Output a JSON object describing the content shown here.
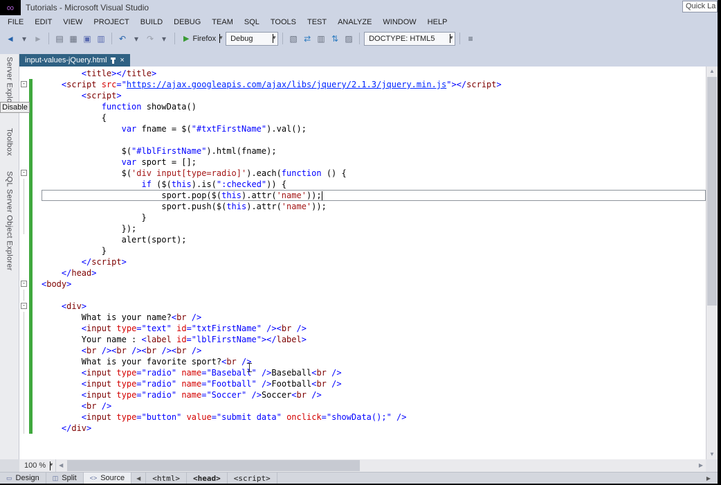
{
  "window": {
    "title": "Tutorials - Microsoft Visual Studio",
    "quick_launch": "Quick La",
    "logo_glyph": "∞"
  },
  "menu": {
    "items": [
      "FILE",
      "EDIT",
      "VIEW",
      "PROJECT",
      "BUILD",
      "DEBUG",
      "TEAM",
      "SQL",
      "TOOLS",
      "TEST",
      "ANALYZE",
      "WINDOW",
      "HELP"
    ]
  },
  "toolbar": {
    "nav_icons": [
      {
        "name": "navigate-back-icon",
        "glyph": "◄",
        "color": "#2563ab"
      },
      {
        "name": "navigate-back-dropdown-icon",
        "glyph": "▾",
        "color": "#5a6170"
      },
      {
        "name": "navigate-forward-icon",
        "glyph": "►",
        "color": "#9aa0ac"
      }
    ],
    "file_icons": [
      {
        "name": "new-file-icon",
        "glyph": "▤",
        "color": "#68707f"
      },
      {
        "name": "open-file-icon",
        "glyph": "▦",
        "color": "#68707f"
      },
      {
        "name": "save-icon",
        "glyph": "▣",
        "color": "#5a6bb0"
      },
      {
        "name": "save-all-icon",
        "glyph": "▥",
        "color": "#5a6bb0"
      }
    ],
    "edit_icons": [
      {
        "name": "undo-icon",
        "glyph": "↶",
        "color": "#2563ab"
      },
      {
        "name": "undo-dropdown-icon",
        "glyph": "▾",
        "color": "#5a6170"
      },
      {
        "name": "redo-icon",
        "glyph": "↷",
        "color": "#9aa0ac"
      },
      {
        "name": "redo-dropdown-icon",
        "glyph": "▾",
        "color": "#5a6170"
      }
    ],
    "run": {
      "play_glyph": "▶",
      "browser": "Firefox",
      "caret": "▾"
    },
    "config": {
      "value": "Debug",
      "caret": "▾"
    },
    "mid_icons": [
      {
        "name": "attach-debugger-icon",
        "glyph": "▧",
        "color": "#68707f"
      },
      {
        "name": "page-inspector-icon",
        "glyph": "⇄",
        "color": "#2e7cc0"
      },
      {
        "name": "browser-preview-icon",
        "glyph": "▥",
        "color": "#68707f"
      },
      {
        "name": "sync-icon",
        "glyph": "⇅",
        "color": "#2e7cc0"
      },
      {
        "name": "stylesheet-icon",
        "glyph": "▨",
        "color": "#68707f"
      }
    ],
    "doctype": {
      "value": "DOCTYPE: HTML5",
      "caret": "▾"
    },
    "right_icons": [
      {
        "name": "formatting-icon",
        "glyph": "≡",
        "color": "#474e5c"
      }
    ]
  },
  "tabstrip": {
    "tab_label": "input-values-jQuery.html",
    "close_icon": "×"
  },
  "side_panel": {
    "tabs": [
      "Server Explorer",
      "Toolbox",
      "SQL Server Object Explorer"
    ],
    "disable_label": "Disable"
  },
  "scrollbars": {
    "up": "▲",
    "down": "▼",
    "left": "◀",
    "right": "▶"
  },
  "bottom": {
    "zoom": "100 %",
    "zoom_caret": "▾",
    "views": [
      {
        "label": "Design",
        "icon": "▭",
        "active": false
      },
      {
        "label": "Split",
        "icon": "◫",
        "active": false
      },
      {
        "label": "Source",
        "icon": "<>",
        "active": true
      }
    ],
    "nav_left": "◀",
    "nav_right": "▶",
    "breadcrumb": [
      {
        "label": "<html>",
        "active": false
      },
      {
        "label": "<head>",
        "active": true
      },
      {
        "label": "<script>",
        "active": false
      }
    ]
  },
  "editor": {
    "fold_glyph": "-",
    "lines": [
      {
        "ch": 0,
        "s": [
          [
            "p",
            "        "
          ],
          [
            "b",
            "<"
          ],
          [
            "m",
            "title"
          ],
          [
            "b",
            "></"
          ],
          [
            "m",
            "title"
          ],
          [
            "b",
            ">"
          ]
        ]
      },
      {
        "ch": 1,
        "f": 1,
        "s": [
          [
            "p",
            "    "
          ],
          [
            "b",
            "<"
          ],
          [
            "m",
            "script"
          ],
          [
            "p",
            " "
          ],
          [
            "r",
            "src"
          ],
          [
            "b",
            "=\""
          ],
          [
            "l",
            "https://ajax.googleapis.com/ajax/libs/jquery/2.1.3/jquery.min.js"
          ],
          [
            "b",
            "\"></"
          ],
          [
            "m",
            "script"
          ],
          [
            "b",
            ">"
          ]
        ]
      },
      {
        "ch": 1,
        "s": [
          [
            "p",
            "        "
          ],
          [
            "b",
            "<"
          ],
          [
            "m",
            "script"
          ],
          [
            "b",
            ">"
          ]
        ]
      },
      {
        "ch": 1,
        "s": [
          [
            "p",
            "            "
          ],
          [
            "b",
            "function"
          ],
          [
            "p",
            " showData()"
          ]
        ]
      },
      {
        "ch": 1,
        "s": [
          [
            "p",
            "            {"
          ]
        ]
      },
      {
        "ch": 1,
        "s": [
          [
            "p",
            "                "
          ],
          [
            "b",
            "var"
          ],
          [
            "p",
            " fname = $("
          ],
          [
            "b",
            "\"#txtFirstName\""
          ],
          [
            "p",
            ").val();"
          ]
        ]
      },
      {
        "ch": 1,
        "s": []
      },
      {
        "ch": 1,
        "s": [
          [
            "p",
            "                $("
          ],
          [
            "b",
            "\"#lblFirstName\""
          ],
          [
            "p",
            ").html(fname);"
          ]
        ]
      },
      {
        "ch": 1,
        "s": [
          [
            "p",
            "                "
          ],
          [
            "b",
            "var"
          ],
          [
            "p",
            " sport = [];"
          ]
        ]
      },
      {
        "ch": 1,
        "f": 1,
        "s": [
          [
            "p",
            "                $("
          ],
          [
            "s",
            "'div input[type=radio]'"
          ],
          [
            "p",
            ").each("
          ],
          [
            "b",
            "function"
          ],
          [
            "p",
            " () {"
          ]
        ]
      },
      {
        "ch": 1,
        "g": 1,
        "s": [
          [
            "p",
            "                    "
          ],
          [
            "b",
            "if"
          ],
          [
            "p",
            " ($("
          ],
          [
            "b",
            "this"
          ],
          [
            "p",
            ").is("
          ],
          [
            "b",
            "\":checked\""
          ],
          [
            "p",
            ")) {"
          ]
        ]
      },
      {
        "ch": 1,
        "g": 1,
        "cur": 1,
        "caret": 1,
        "s": [
          [
            "p",
            "                        sport.pop($("
          ],
          [
            "b",
            "this"
          ],
          [
            "p",
            ").attr("
          ],
          [
            "s",
            "'name'"
          ],
          [
            "p",
            "));"
          ]
        ]
      },
      {
        "ch": 1,
        "g": 1,
        "s": [
          [
            "p",
            "                        sport.push($("
          ],
          [
            "b",
            "this"
          ],
          [
            "p",
            ").attr("
          ],
          [
            "s",
            "'name'"
          ],
          [
            "p",
            "));"
          ]
        ]
      },
      {
        "ch": 1,
        "g": 1,
        "s": [
          [
            "p",
            "                    }"
          ]
        ]
      },
      {
        "ch": 1,
        "g": 1,
        "s": [
          [
            "p",
            "                });"
          ]
        ]
      },
      {
        "ch": 1,
        "s": [
          [
            "p",
            "                alert(sport);"
          ]
        ]
      },
      {
        "ch": 1,
        "s": [
          [
            "p",
            "            }"
          ]
        ]
      },
      {
        "ch": 1,
        "s": [
          [
            "p",
            "        "
          ],
          [
            "b",
            "</"
          ],
          [
            "m",
            "script"
          ],
          [
            "b",
            ">"
          ]
        ]
      },
      {
        "ch": 1,
        "s": [
          [
            "p",
            "    "
          ],
          [
            "b",
            "</"
          ],
          [
            "m",
            "head"
          ],
          [
            "b",
            ">"
          ]
        ]
      },
      {
        "ch": 1,
        "f": 1,
        "s": [
          [
            "b",
            "<"
          ],
          [
            "m",
            "body"
          ],
          [
            "b",
            ">"
          ]
        ]
      },
      {
        "ch": 1,
        "g": 1,
        "s": []
      },
      {
        "ch": 1,
        "f": 1,
        "s": [
          [
            "p",
            "    "
          ],
          [
            "b",
            "<"
          ],
          [
            "m",
            "div"
          ],
          [
            "b",
            ">"
          ]
        ]
      },
      {
        "ch": 1,
        "g": 1,
        "s": [
          [
            "p",
            "        What is your name?"
          ],
          [
            "b",
            "<"
          ],
          [
            "m",
            "br"
          ],
          [
            "p",
            " "
          ],
          [
            "b",
            "/>"
          ]
        ]
      },
      {
        "ch": 1,
        "g": 1,
        "s": [
          [
            "p",
            "        "
          ],
          [
            "b",
            "<"
          ],
          [
            "m",
            "input"
          ],
          [
            "p",
            " "
          ],
          [
            "r",
            "type"
          ],
          [
            "b",
            "=\"text\""
          ],
          [
            "p",
            " "
          ],
          [
            "r",
            "id"
          ],
          [
            "b",
            "=\"txtFirstName\""
          ],
          [
            "p",
            " "
          ],
          [
            "b",
            "/><"
          ],
          [
            "m",
            "br"
          ],
          [
            "p",
            " "
          ],
          [
            "b",
            "/>"
          ]
        ]
      },
      {
        "ch": 1,
        "g": 1,
        "s": [
          [
            "p",
            "        Your name : "
          ],
          [
            "b",
            "<"
          ],
          [
            "m",
            "label"
          ],
          [
            "p",
            " "
          ],
          [
            "r",
            "id"
          ],
          [
            "b",
            "=\"lblFirstName\""
          ],
          [
            "b",
            "></"
          ],
          [
            "m",
            "label"
          ],
          [
            "b",
            ">"
          ]
        ]
      },
      {
        "ch": 1,
        "g": 1,
        "s": [
          [
            "p",
            "        "
          ],
          [
            "b",
            "<"
          ],
          [
            "m",
            "br"
          ],
          [
            "p",
            " "
          ],
          [
            "b",
            "/><"
          ],
          [
            "m",
            "br"
          ],
          [
            "p",
            " "
          ],
          [
            "b",
            "/><"
          ],
          [
            "m",
            "br"
          ],
          [
            "p",
            " "
          ],
          [
            "b",
            "/><"
          ],
          [
            "m",
            "br"
          ],
          [
            "p",
            " "
          ],
          [
            "b",
            "/>"
          ]
        ]
      },
      {
        "ch": 1,
        "g": 1,
        "s": [
          [
            "p",
            "        What is your favorite sport?"
          ],
          [
            "b",
            "<"
          ],
          [
            "m",
            "br"
          ],
          [
            "p",
            " "
          ],
          [
            "b",
            "/>"
          ]
        ]
      },
      {
        "ch": 1,
        "g": 1,
        "s": [
          [
            "p",
            "        "
          ],
          [
            "b",
            "<"
          ],
          [
            "m",
            "input"
          ],
          [
            "p",
            " "
          ],
          [
            "r",
            "type"
          ],
          [
            "b",
            "=\"radio\""
          ],
          [
            "p",
            " "
          ],
          [
            "r",
            "name"
          ],
          [
            "b",
            "=\"Baseball\""
          ],
          [
            "p",
            " "
          ],
          [
            "b",
            "/>"
          ],
          [
            "p",
            "Baseball"
          ],
          [
            "b",
            "<"
          ],
          [
            "m",
            "br"
          ],
          [
            "p",
            " "
          ],
          [
            "b",
            "/>"
          ]
        ]
      },
      {
        "ch": 1,
        "g": 1,
        "s": [
          [
            "p",
            "        "
          ],
          [
            "b",
            "<"
          ],
          [
            "m",
            "input"
          ],
          [
            "p",
            " "
          ],
          [
            "r",
            "type"
          ],
          [
            "b",
            "=\"radio\""
          ],
          [
            "p",
            " "
          ],
          [
            "r",
            "name"
          ],
          [
            "b",
            "=\"Football\""
          ],
          [
            "p",
            " "
          ],
          [
            "b",
            "/>"
          ],
          [
            "p",
            "Football"
          ],
          [
            "b",
            "<"
          ],
          [
            "m",
            "br"
          ],
          [
            "p",
            " "
          ],
          [
            "b",
            "/>"
          ]
        ]
      },
      {
        "ch": 1,
        "g": 1,
        "s": [
          [
            "p",
            "        "
          ],
          [
            "b",
            "<"
          ],
          [
            "m",
            "input"
          ],
          [
            "p",
            " "
          ],
          [
            "r",
            "type"
          ],
          [
            "b",
            "=\"radio\""
          ],
          [
            "p",
            " "
          ],
          [
            "r",
            "name"
          ],
          [
            "b",
            "=\"Soccer\""
          ],
          [
            "p",
            " "
          ],
          [
            "b",
            "/>"
          ],
          [
            "p",
            "Soccer"
          ],
          [
            "b",
            "<"
          ],
          [
            "m",
            "br"
          ],
          [
            "p",
            " "
          ],
          [
            "b",
            "/>"
          ]
        ]
      },
      {
        "ch": 1,
        "g": 1,
        "s": [
          [
            "p",
            "        "
          ],
          [
            "b",
            "<"
          ],
          [
            "m",
            "br"
          ],
          [
            "p",
            " "
          ],
          [
            "b",
            "/>"
          ]
        ]
      },
      {
        "ch": 1,
        "g": 1,
        "s": [
          [
            "p",
            "        "
          ],
          [
            "b",
            "<"
          ],
          [
            "m",
            "input"
          ],
          [
            "p",
            " "
          ],
          [
            "r",
            "type"
          ],
          [
            "b",
            "=\"button\""
          ],
          [
            "p",
            " "
          ],
          [
            "r",
            "value"
          ],
          [
            "b",
            "=\"submit data\""
          ],
          [
            "p",
            " "
          ],
          [
            "r",
            "onclick"
          ],
          [
            "b",
            "=\"showData();\""
          ],
          [
            "p",
            " "
          ],
          [
            "b",
            "/>"
          ]
        ]
      },
      {
        "ch": 1,
        "g": 1,
        "s": [
          [
            "p",
            "    "
          ],
          [
            "b",
            "</"
          ],
          [
            "m",
            "div"
          ],
          [
            "b",
            ">"
          ]
        ]
      }
    ]
  }
}
